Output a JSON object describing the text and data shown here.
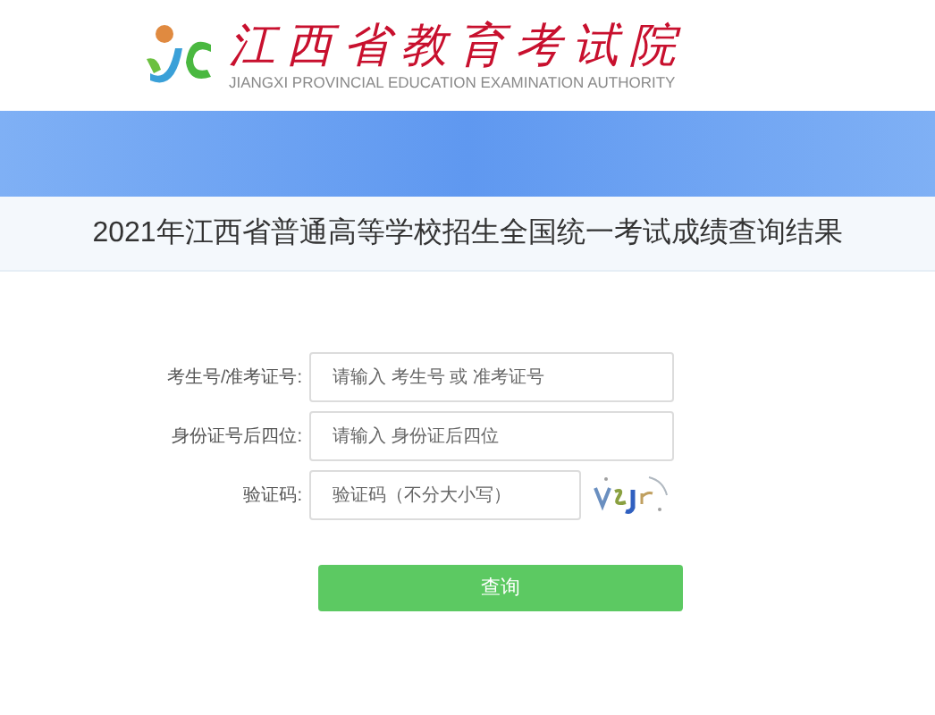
{
  "header": {
    "org_name": "江西省教育考试院",
    "org_name_en": "JIANGXI PROVINCIAL EDUCATION EXAMINATION AUTHORITY"
  },
  "page_title": "2021年江西省普通高等学校招生全国统一考试成绩查询结果",
  "form": {
    "fields": [
      {
        "kind": "text",
        "label": "考生号/准考证号:",
        "placeholder": "请输入 考生号 或 准考证号"
      },
      {
        "kind": "text",
        "label": "身份证号后四位:",
        "placeholder": "请输入 身份证后四位"
      },
      {
        "kind": "captcha",
        "label": "验证码:",
        "placeholder": "验证码（不分大小写）"
      }
    ],
    "submit": "查询"
  }
}
